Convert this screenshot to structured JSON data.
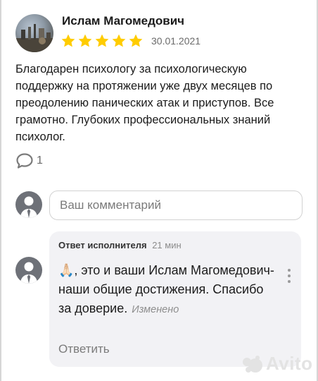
{
  "review": {
    "author": "Ислам Магомедович",
    "rating": 5,
    "date": "30.01.2021",
    "text": "Благодарен психологу за психологическую поддержку на протяжении уже двух месяцев по преодолению панических атак и приступов. Все грамотно. Глубоких профессиональных знаний психолог.",
    "reply_count": "1"
  },
  "comment_box": {
    "placeholder": "Ваш комментарий"
  },
  "executor_reply": {
    "header_label": "Ответ исполнителя",
    "time": "21 мин",
    "emoji": "🙏🏻",
    "text": ", это и ваши Ислам Магомедович- наши общие достижения. Спасибо за доверие.",
    "edited_label": "Изменено",
    "reply_button": "Ответить"
  },
  "watermark": {
    "brand": "Avito"
  },
  "colors": {
    "star": "#ffcc00",
    "card_bg": "#f2f2f5",
    "avatar_placeholder": "#6e7178"
  }
}
